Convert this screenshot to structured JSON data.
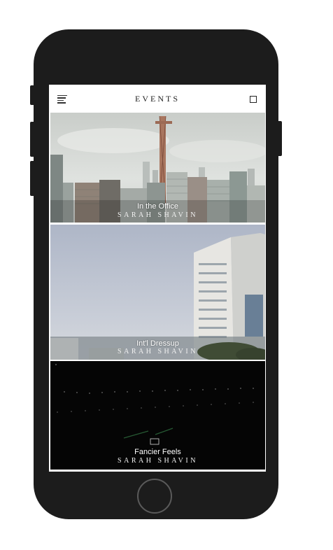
{
  "header": {
    "title": "EVENTS",
    "menu_icon": "hamburger-menu-icon",
    "right_icon": "square-icon"
  },
  "cards": [
    {
      "title": "In the Office",
      "subtitle": "SARAH SHAVIN"
    },
    {
      "title": "Int'l Dressup",
      "subtitle": "SARAH SHAVIN"
    },
    {
      "title": "Fancier Feels",
      "subtitle": "SARAH SHAVIN"
    }
  ],
  "colors": {
    "device_body": "#1c1c1c",
    "header_text": "#222222",
    "overlay_text": "#ffffff"
  }
}
